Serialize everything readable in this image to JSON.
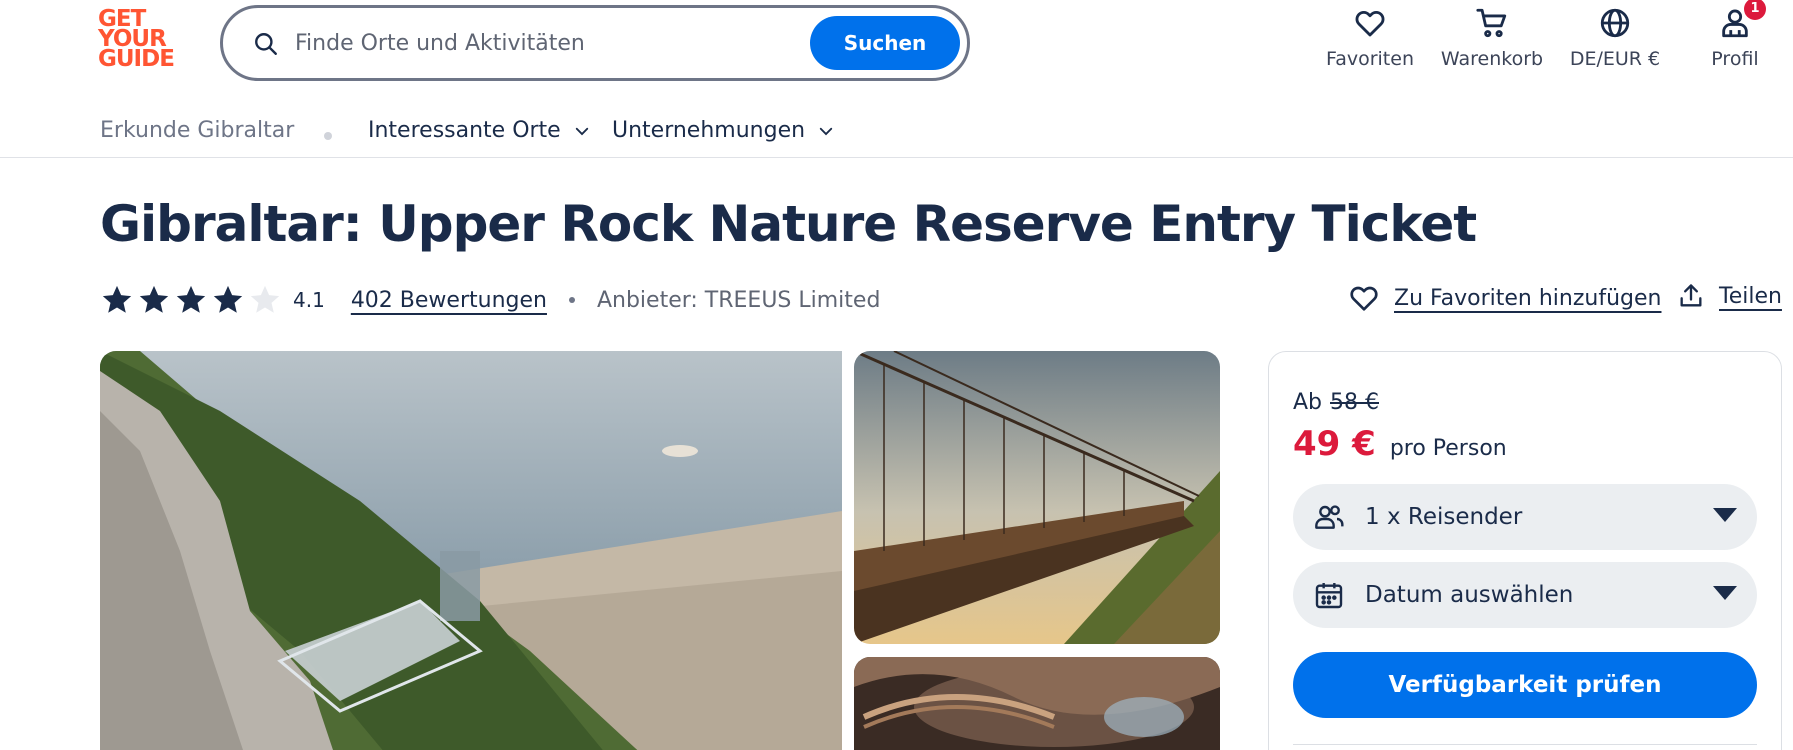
{
  "header": {
    "logo_lines": [
      "GET",
      "YOUR",
      "GUIDE"
    ],
    "search_placeholder": "Finde Orte und Aktivitäten",
    "search_button": "Suchen",
    "nav": {
      "favorites": "Favoriten",
      "cart": "Warenkorb",
      "language": "DE/EUR €",
      "profile": "Profil",
      "profile_badge": "1"
    }
  },
  "subnav": {
    "explore": "Erkunde Gibraltar",
    "places": "Interessante Orte",
    "activities": "Unternehmungen"
  },
  "product": {
    "title": "Gibraltar: Upper Rock Nature Reserve Entry Ticket",
    "rating": "4.1",
    "rating_value": 4.1,
    "reviews": "402 Bewertungen",
    "provider": "Anbieter: TREEUS Limited",
    "add_favorite": "Zu Favoriten hinzufügen",
    "share": "Teilen"
  },
  "booking": {
    "from_label": "Ab",
    "old_price": "58 €",
    "price": "49 €",
    "per_person": "pro Person",
    "travelers": "1 x Reisender",
    "date": "Datum auswählen",
    "check_button": "Verfügbarkeit prüfen"
  },
  "colors": {
    "brand_orange": "#ff5533",
    "primary_blue": "#0071eb",
    "price_red": "#dc1a3c",
    "text_dark": "#1a2b49"
  }
}
